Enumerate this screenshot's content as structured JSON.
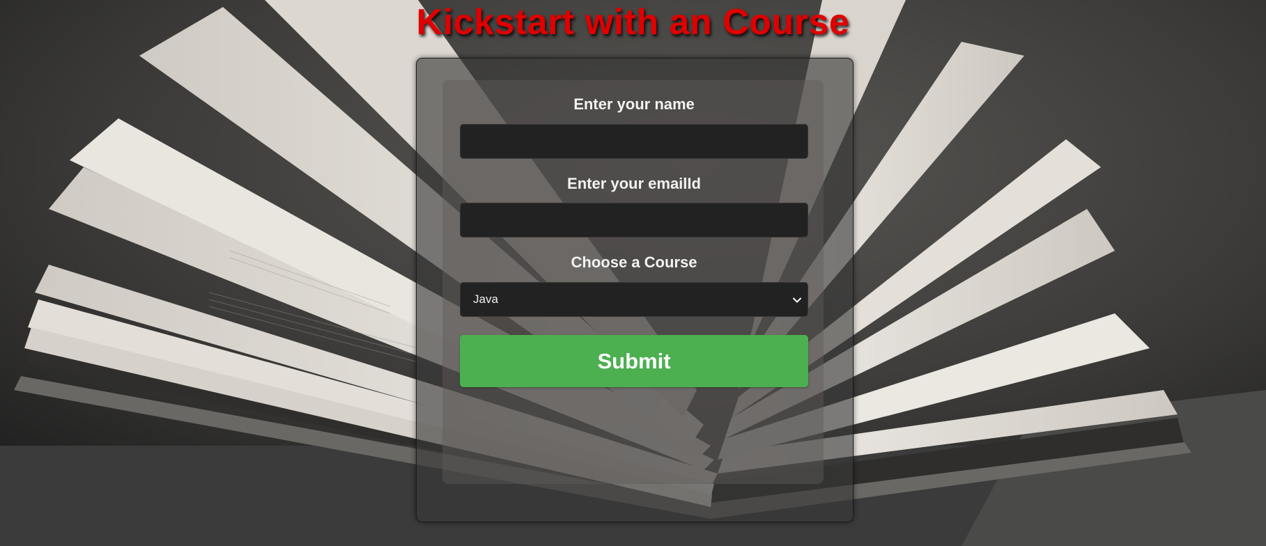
{
  "page": {
    "title": "Kickstart with an Course",
    "title_color": "#e00000"
  },
  "form": {
    "name_label": "Enter your name",
    "name_value": "",
    "email_label": "Enter your emailId",
    "email_value": "",
    "course_label": "Choose a Course",
    "course_selected": "Java",
    "submit_label": "Submit",
    "submit_color": "#4caf50"
  },
  "background": {
    "description_icon": "open-book-photo"
  }
}
